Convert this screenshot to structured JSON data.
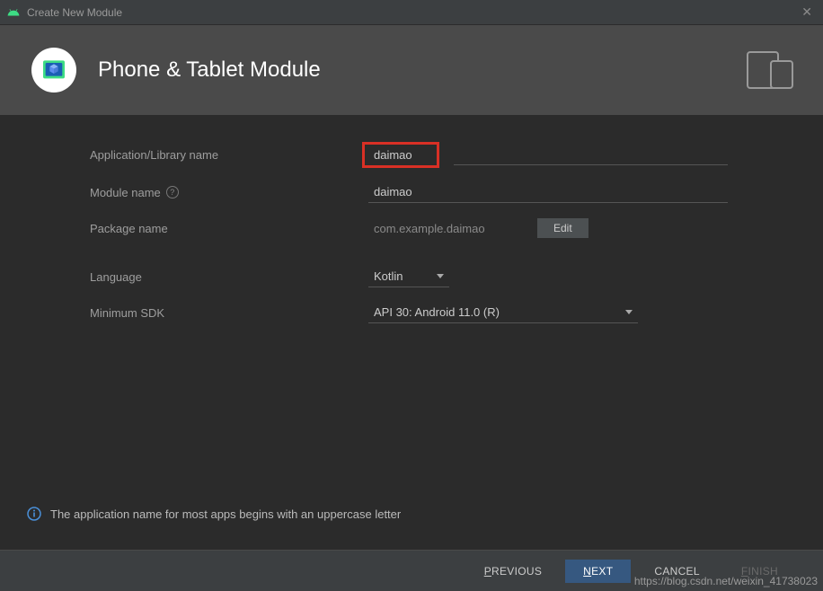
{
  "titlebar": {
    "title": "Create New Module"
  },
  "header": {
    "title": "Phone & Tablet Module"
  },
  "form": {
    "app_name_label": "Application/Library name",
    "app_name_value": "daimao",
    "module_name_label": "Module name",
    "module_name_value": "daimao",
    "package_name_label": "Package name",
    "package_name_value": "com.example.daimao",
    "edit_label": "Edit",
    "language_label": "Language",
    "language_value": "Kotlin",
    "min_sdk_label": "Minimum SDK",
    "min_sdk_value": "API 30: Android 11.0 (R)"
  },
  "info": {
    "message": "The application name for most apps begins with an uppercase letter"
  },
  "footer": {
    "previous": "REVIOUS",
    "previous_u": "P",
    "next": "EXT",
    "next_u": "N",
    "cancel": "CANCEL",
    "finish": "INISH",
    "finish_u": "F"
  },
  "watermark": "https://blog.csdn.net/weixin_41738023"
}
